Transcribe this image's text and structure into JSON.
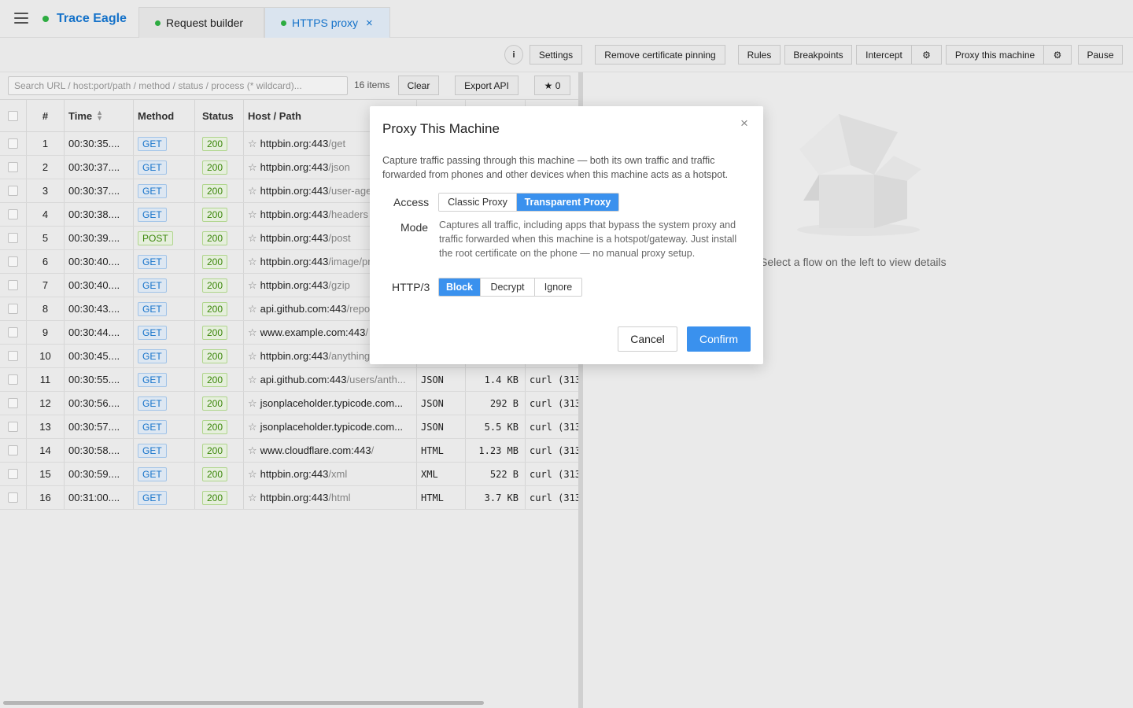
{
  "app": {
    "name": "Trace Eagle",
    "menu_icon": "hamburger-icon",
    "tabs": [
      {
        "label": "Request builder"
      },
      {
        "label": "HTTPS proxy",
        "close": "×"
      }
    ]
  },
  "toolbar": {
    "info": "i",
    "settings": "Settings",
    "remove_pinning": "Remove certificate pinning",
    "rules": "Rules",
    "breakpoints": "Breakpoints",
    "intercept": "Intercept",
    "intercept_gear": "⚙",
    "proxy_machine": "Proxy this machine",
    "proxy_gear": "⚙",
    "pause": "Pause"
  },
  "filter": {
    "placeholder": "Search URL / host:port/path / method / status / process (* wildcard)...",
    "count": "16 items",
    "clear": "Clear",
    "export": "Export API",
    "starred": "★ 0"
  },
  "table": {
    "headers": {
      "num": "#",
      "time": "Time",
      "method": "Method",
      "status": "Status",
      "host": "Host / Path"
    },
    "rows": [
      {
        "num": "1",
        "time": "00:30:35....",
        "method": "GET",
        "status": "200",
        "host": "httpbin.org:443",
        "path": "/get",
        "type": "",
        "size": "",
        "client": ""
      },
      {
        "num": "2",
        "time": "00:30:37....",
        "method": "GET",
        "status": "200",
        "host": "httpbin.org:443",
        "path": "/json",
        "type": "",
        "size": "",
        "client": ""
      },
      {
        "num": "3",
        "time": "00:30:37....",
        "method": "GET",
        "status": "200",
        "host": "httpbin.org:443",
        "path": "/user-agent",
        "type": "",
        "size": "",
        "client": ""
      },
      {
        "num": "4",
        "time": "00:30:38....",
        "method": "GET",
        "status": "200",
        "host": "httpbin.org:443",
        "path": "/headers",
        "type": "",
        "size": "",
        "client": ""
      },
      {
        "num": "5",
        "time": "00:30:39....",
        "method": "POST",
        "status": "200",
        "host": "httpbin.org:443",
        "path": "/post",
        "type": "",
        "size": "",
        "client": ""
      },
      {
        "num": "6",
        "time": "00:30:40....",
        "method": "GET",
        "status": "200",
        "host": "httpbin.org:443",
        "path": "/image/png",
        "type": "",
        "size": "",
        "client": ""
      },
      {
        "num": "7",
        "time": "00:30:40....",
        "method": "GET",
        "status": "200",
        "host": "httpbin.org:443",
        "path": "/gzip",
        "type": "",
        "size": "",
        "client": ""
      },
      {
        "num": "8",
        "time": "00:30:43....",
        "method": "GET",
        "status": "200",
        "host": "api.github.com:443",
        "path": "/repos",
        "type": "",
        "size": "",
        "client": ""
      },
      {
        "num": "9",
        "time": "00:30:44....",
        "method": "GET",
        "status": "200",
        "host": "www.example.com:443",
        "path": "/",
        "type": "",
        "size": "",
        "client": ""
      },
      {
        "num": "10",
        "time": "00:30:45....",
        "method": "GET",
        "status": "200",
        "host": "httpbin.org:443",
        "path": "/anything",
        "type": "",
        "size": "",
        "client": ""
      },
      {
        "num": "11",
        "time": "00:30:55....",
        "method": "GET",
        "status": "200",
        "host": "api.github.com:443",
        "path": "/users/anth...",
        "type": "JSON",
        "size": "1.4 KB",
        "client": "curl (313"
      },
      {
        "num": "12",
        "time": "00:30:56....",
        "method": "GET",
        "status": "200",
        "host": "jsonplaceholder.typicode.com...",
        "path": "",
        "type": "JSON",
        "size": "292 B",
        "client": "curl (313"
      },
      {
        "num": "13",
        "time": "00:30:57....",
        "method": "GET",
        "status": "200",
        "host": "jsonplaceholder.typicode.com...",
        "path": "",
        "type": "JSON",
        "size": "5.5 KB",
        "client": "curl (313"
      },
      {
        "num": "14",
        "time": "00:30:58....",
        "method": "GET",
        "status": "200",
        "host": "www.cloudflare.com:443",
        "path": "/",
        "type": "HTML",
        "size": "1.23 MB",
        "client": "curl (313"
      },
      {
        "num": "15",
        "time": "00:30:59....",
        "method": "GET",
        "status": "200",
        "host": "httpbin.org:443",
        "path": "/xml",
        "type": "XML",
        "size": "522 B",
        "client": "curl (313"
      },
      {
        "num": "16",
        "time": "00:31:00....",
        "method": "GET",
        "status": "200",
        "host": "httpbin.org:443",
        "path": "/html",
        "type": "HTML",
        "size": "3.7 KB",
        "client": "curl (313"
      }
    ]
  },
  "detail": {
    "empty_text": "Select a flow on the left to view details",
    "empty_icon": "empty-box-icon"
  },
  "modal": {
    "title": "Proxy This Machine",
    "close": "×",
    "description": "Capture traffic passing through this machine — both its own traffic and traffic forwarded from phones and other devices when this machine acts as a hotspot.",
    "access_label": "Access",
    "mode_label": "Mode",
    "access_options": [
      "Classic Proxy",
      "Transparent Proxy"
    ],
    "access_selected": "Transparent Proxy",
    "mode_description": "Captures all traffic, including apps that bypass the system proxy and traffic forwarded when this machine is a hotspot/gateway. Just install the root certificate on the phone — no manual proxy setup.",
    "http3_label": "HTTP/3",
    "http3_options": [
      "Block",
      "Decrypt",
      "Ignore"
    ],
    "http3_selected": "Block",
    "cancel": "Cancel",
    "confirm": "Confirm"
  },
  "colors": {
    "accent": "#3a91ee",
    "brand": "#1677d2",
    "status_green": "#2fb344"
  }
}
